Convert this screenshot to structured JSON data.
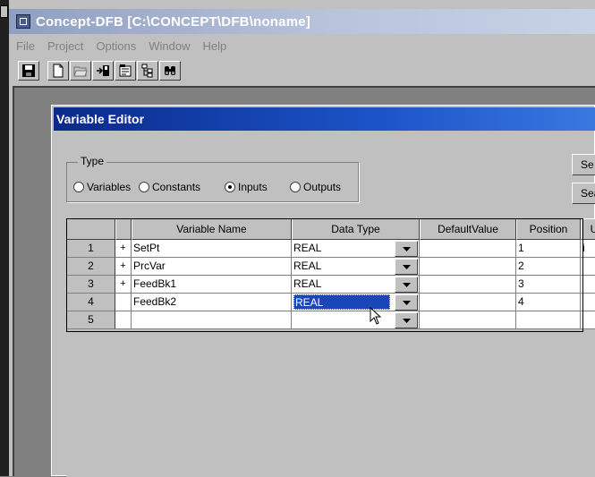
{
  "window": {
    "title": "Concept-DFB [C:\\CONCEPT\\DFB\\noname]",
    "menu": [
      "File",
      "Project",
      "Options",
      "Window",
      "Help"
    ],
    "toolbar": [
      "save-icon",
      "new-file-icon",
      "open-folder-icon",
      "export-icon",
      "properties-icon",
      "tree-icon",
      "find-icon"
    ]
  },
  "dialog": {
    "title": "Variable Editor",
    "type_group": {
      "legend": "Type",
      "options": [
        "Variables",
        "Constants",
        "Inputs",
        "Outputs"
      ],
      "selected": "Inputs"
    },
    "side_buttons": [
      "Se",
      "Sea"
    ],
    "grid": {
      "columns": [
        "Variable Name",
        "Data Type",
        "DefaultValue",
        "Position",
        "U"
      ],
      "rows": [
        {
          "num": "1",
          "expander": "+",
          "name": "SetPt",
          "type": "REAL",
          "default": "",
          "position": "1",
          "u": "i"
        },
        {
          "num": "2",
          "expander": "+",
          "name": "PrcVar",
          "type": "REAL",
          "default": "",
          "position": "2",
          "u": ""
        },
        {
          "num": "3",
          "expander": "+",
          "name": "FeedBk1",
          "type": "REAL",
          "default": "",
          "position": "3",
          "u": ""
        },
        {
          "num": "4",
          "expander": "",
          "name": "FeedBk2",
          "type": "REAL",
          "default": "",
          "position": "4",
          "u": ""
        },
        {
          "num": "5",
          "expander": "",
          "name": "",
          "type": "",
          "default": "",
          "position": "",
          "u": ""
        }
      ],
      "selected_row": 4
    }
  }
}
